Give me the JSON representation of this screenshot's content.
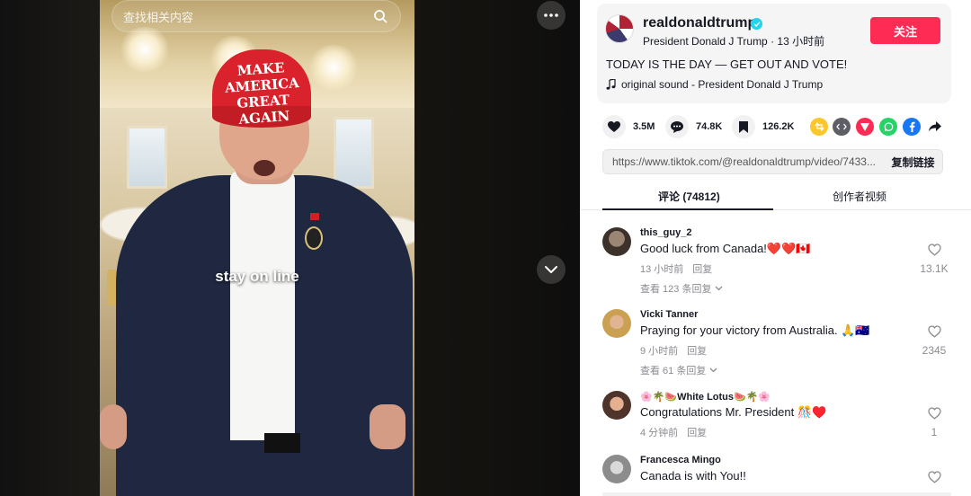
{
  "search": {
    "placeholder": "查找相关内容"
  },
  "video": {
    "caption": "stay on line",
    "hat_text_line1": "MAKE AMERICA",
    "hat_text_line2": "GREAT AGAIN"
  },
  "author": {
    "username": "realdonaldtrump",
    "display_name": "President Donald J Trump",
    "time_ago": "13 小时前",
    "follow_label": "关注",
    "caption": "TODAY IS THE DAY — GET OUT AND VOTE!",
    "music": "original sound - President Donald J Trump"
  },
  "stats": {
    "likes": "3.5M",
    "comments": "74.8K",
    "saves": "126.2K"
  },
  "link": {
    "url": "https://www.tiktok.com/@realdonaldtrump/video/7433...",
    "copy_label": "复制链接"
  },
  "tabs": [
    {
      "label": "评论 (74812)",
      "active": true
    },
    {
      "label": "创作者视频",
      "active": false
    }
  ],
  "comments": [
    {
      "name": "this_guy_2",
      "text": "Good luck from Canada!❤️❤️🇨🇦",
      "time": "13 小时前",
      "reply_label": "回复",
      "view_replies": "查看 123 条回复",
      "likes": "13.1K",
      "avatar_color": "#5a4a3e"
    },
    {
      "name": "Vicki Tanner",
      "text": "Praying for your victory from Australia. 🙏🇦🇺",
      "time": "9 小时前",
      "reply_label": "回复",
      "view_replies": "查看 61 条回复",
      "likes": "2345",
      "avatar_color": "#c7a05a"
    },
    {
      "name": "🌸🌴🍉White Lotus🍉🌴🌸",
      "text": "Congratulations Mr. President 🎊♥️",
      "time": "4 分钟前",
      "reply_label": "回复",
      "view_replies": "",
      "likes": "1",
      "avatar_color": "#6b4a3a"
    },
    {
      "name": "Francesca Mingo",
      "text": "Canada is with You!!",
      "time": "",
      "reply_label": "",
      "view_replies": "",
      "likes": "",
      "avatar_color": "#9a9a9a"
    }
  ],
  "colors": {
    "accent": "#fe2c55",
    "verified": "#20d5ec",
    "text": "#161823",
    "muted": "#8a8b91"
  }
}
